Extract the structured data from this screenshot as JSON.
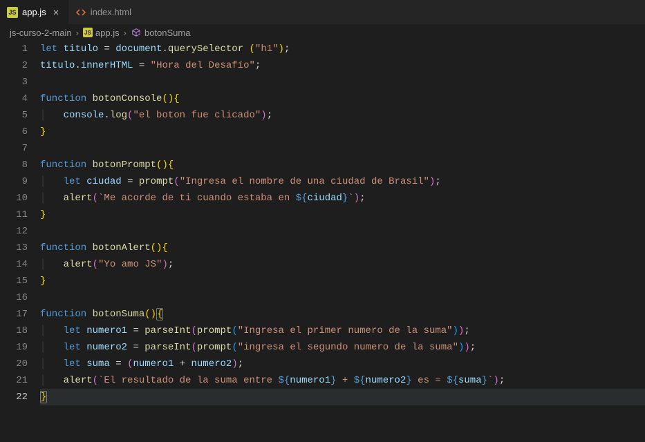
{
  "tabs": [
    {
      "label": "app.js",
      "active": true,
      "iconText": "JS",
      "closeable": true
    },
    {
      "label": "index.html",
      "active": false,
      "iconText": "<>",
      "closeable": false
    }
  ],
  "breadcrumb": {
    "folder": "js-curso-2-main",
    "file": "app.js",
    "symbol": "botonSuma"
  },
  "code": {
    "lines": [
      {
        "n": 1,
        "tokens": [
          [
            "kw",
            "let"
          ],
          [
            "pun",
            " "
          ],
          [
            "var",
            "titulo"
          ],
          [
            "pun",
            " "
          ],
          [
            "pun",
            "="
          ],
          [
            "pun",
            " "
          ],
          [
            "var",
            "document"
          ],
          [
            "pun",
            "."
          ],
          [
            "fn",
            "querySelector"
          ],
          [
            "pun",
            " "
          ],
          [
            "brace1",
            "("
          ],
          [
            "str",
            "\"h1\""
          ],
          [
            "brace1",
            ")"
          ],
          [
            "pun",
            ";"
          ]
        ]
      },
      {
        "n": 2,
        "tokens": [
          [
            "var",
            "titulo"
          ],
          [
            "pun",
            "."
          ],
          [
            "var",
            "innerHTML"
          ],
          [
            "pun",
            " "
          ],
          [
            "pun",
            "="
          ],
          [
            "pun",
            " "
          ],
          [
            "str",
            "\"Hora del Desafío\""
          ],
          [
            "pun",
            ";"
          ]
        ]
      },
      {
        "n": 3,
        "tokens": []
      },
      {
        "n": 4,
        "tokens": [
          [
            "kw",
            "function"
          ],
          [
            "pun",
            " "
          ],
          [
            "fn",
            "botonConsole"
          ],
          [
            "brace1",
            "("
          ],
          [
            "brace1",
            ")"
          ],
          [
            "brace1",
            "{"
          ]
        ]
      },
      {
        "n": 5,
        "indent": 1,
        "tokens": [
          [
            "var",
            "console"
          ],
          [
            "pun",
            "."
          ],
          [
            "fn",
            "log"
          ],
          [
            "brace2",
            "("
          ],
          [
            "str",
            "\"el boton fue clicado\""
          ],
          [
            "brace2",
            ")"
          ],
          [
            "pun",
            ";"
          ]
        ]
      },
      {
        "n": 6,
        "tokens": [
          [
            "brace1",
            "}"
          ]
        ]
      },
      {
        "n": 7,
        "tokens": []
      },
      {
        "n": 8,
        "tokens": [
          [
            "kw",
            "function"
          ],
          [
            "pun",
            " "
          ],
          [
            "fn",
            "botonPrompt"
          ],
          [
            "brace1",
            "("
          ],
          [
            "brace1",
            ")"
          ],
          [
            "brace1",
            "{"
          ]
        ]
      },
      {
        "n": 9,
        "indent": 1,
        "tokens": [
          [
            "kw",
            "let"
          ],
          [
            "pun",
            " "
          ],
          [
            "var",
            "ciudad"
          ],
          [
            "pun",
            " "
          ],
          [
            "pun",
            "="
          ],
          [
            "pun",
            " "
          ],
          [
            "fn",
            "prompt"
          ],
          [
            "brace2",
            "("
          ],
          [
            "str",
            "\"Ingresa el nombre de una ciudad de Brasil\""
          ],
          [
            "brace2",
            ")"
          ],
          [
            "pun",
            ";"
          ]
        ]
      },
      {
        "n": 10,
        "indent": 1,
        "tokens": [
          [
            "fn",
            "alert"
          ],
          [
            "brace2",
            "("
          ],
          [
            "str",
            "`Me acorde de ti cuando estaba en "
          ],
          [
            "tmpl",
            "${"
          ],
          [
            "var",
            "ciudad"
          ],
          [
            "tmpl",
            "}"
          ],
          [
            "str",
            "`"
          ],
          [
            "brace2",
            ")"
          ],
          [
            "pun",
            ";"
          ]
        ]
      },
      {
        "n": 11,
        "tokens": [
          [
            "brace1",
            "}"
          ]
        ]
      },
      {
        "n": 12,
        "tokens": []
      },
      {
        "n": 13,
        "tokens": [
          [
            "kw",
            "function"
          ],
          [
            "pun",
            " "
          ],
          [
            "fn",
            "botonAlert"
          ],
          [
            "brace1",
            "("
          ],
          [
            "brace1",
            ")"
          ],
          [
            "brace1",
            "{"
          ]
        ]
      },
      {
        "n": 14,
        "indent": 1,
        "tokens": [
          [
            "fn",
            "alert"
          ],
          [
            "brace2",
            "("
          ],
          [
            "str",
            "\"Yo amo JS\""
          ],
          [
            "brace2",
            ")"
          ],
          [
            "pun",
            ";"
          ]
        ]
      },
      {
        "n": 15,
        "tokens": [
          [
            "brace1",
            "}"
          ]
        ]
      },
      {
        "n": 16,
        "tokens": []
      },
      {
        "n": 17,
        "tokens": [
          [
            "kw",
            "function"
          ],
          [
            "pun",
            " "
          ],
          [
            "fn",
            "botonSuma"
          ],
          [
            "brace1",
            "("
          ],
          [
            "brace1",
            ")"
          ],
          [
            "brace1",
            "{"
          ]
        ],
        "bracket_highlight": true
      },
      {
        "n": 18,
        "indent": 1,
        "tokens": [
          [
            "kw",
            "let"
          ],
          [
            "pun",
            " "
          ],
          [
            "var",
            "numero1"
          ],
          [
            "pun",
            " "
          ],
          [
            "pun",
            "="
          ],
          [
            "pun",
            " "
          ],
          [
            "fn",
            "parseInt"
          ],
          [
            "brace2",
            "("
          ],
          [
            "fn",
            "prompt"
          ],
          [
            "brace3",
            "("
          ],
          [
            "str",
            "\"Ingresa el primer numero de la suma\""
          ],
          [
            "brace3",
            ")"
          ],
          [
            "brace2",
            ")"
          ],
          [
            "pun",
            ";"
          ]
        ]
      },
      {
        "n": 19,
        "indent": 1,
        "tokens": [
          [
            "kw",
            "let"
          ],
          [
            "pun",
            " "
          ],
          [
            "var",
            "numero2"
          ],
          [
            "pun",
            " "
          ],
          [
            "pun",
            "="
          ],
          [
            "pun",
            " "
          ],
          [
            "fn",
            "parseInt"
          ],
          [
            "brace2",
            "("
          ],
          [
            "fn",
            "prompt"
          ],
          [
            "brace3",
            "("
          ],
          [
            "str",
            "\"ingresa el segundo numero de la suma\""
          ],
          [
            "brace3",
            ")"
          ],
          [
            "brace2",
            ")"
          ],
          [
            "pun",
            ";"
          ]
        ]
      },
      {
        "n": 20,
        "indent": 1,
        "tokens": [
          [
            "kw",
            "let"
          ],
          [
            "pun",
            " "
          ],
          [
            "var",
            "suma"
          ],
          [
            "pun",
            " "
          ],
          [
            "pun",
            "="
          ],
          [
            "pun",
            " "
          ],
          [
            "brace2",
            "("
          ],
          [
            "var",
            "numero1"
          ],
          [
            "pun",
            " "
          ],
          [
            "pun",
            "+"
          ],
          [
            "pun",
            " "
          ],
          [
            "var",
            "numero2"
          ],
          [
            "brace2",
            ")"
          ],
          [
            "pun",
            ";"
          ]
        ]
      },
      {
        "n": 21,
        "indent": 1,
        "tokens": [
          [
            "fn",
            "alert"
          ],
          [
            "brace2",
            "("
          ],
          [
            "str",
            "`El resultado de la suma entre "
          ],
          [
            "tmpl",
            "${"
          ],
          [
            "var",
            "numero1"
          ],
          [
            "tmpl",
            "}"
          ],
          [
            "str",
            " + "
          ],
          [
            "tmpl",
            "${"
          ],
          [
            "var",
            "numero2"
          ],
          [
            "tmpl",
            "}"
          ],
          [
            "str",
            " es = "
          ],
          [
            "tmpl",
            "${"
          ],
          [
            "var",
            "suma"
          ],
          [
            "tmpl",
            "}"
          ],
          [
            "str",
            "`"
          ],
          [
            "brace2",
            ")"
          ],
          [
            "pun",
            ";"
          ]
        ]
      },
      {
        "n": 22,
        "tokens": [
          [
            "brace1",
            "}"
          ]
        ],
        "current": true,
        "bracket_highlight": true
      }
    ]
  }
}
